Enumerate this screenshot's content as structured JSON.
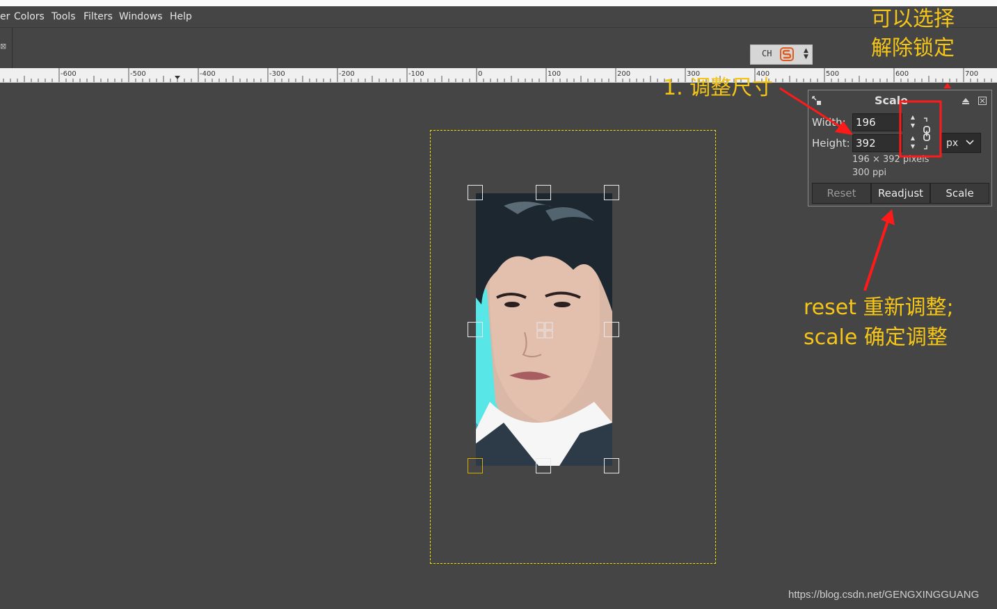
{
  "menubar": {
    "items": [
      "er",
      "Colors",
      "Tools",
      "Filters",
      "Windows",
      "Help"
    ]
  },
  "tool_options": {
    "close_glyph": "⊠"
  },
  "ime": {
    "mode": "CH",
    "logo": "sogou-s-icon"
  },
  "ruler": {
    "labels": [
      "0",
      "-600",
      "-500",
      "-400",
      "-300",
      "-200",
      "-100",
      "0",
      "100",
      "200",
      "300",
      "400",
      "500",
      "600",
      "700"
    ]
  },
  "scale_dialog": {
    "title": "Scale",
    "width_label": "Width:",
    "width_value": "196",
    "height_label": "Height:",
    "height_value": "392",
    "unit": "px",
    "size_info": "196 × 392 pixels",
    "resolution_info": "300 ppi",
    "buttons": {
      "reset": "Reset",
      "readjust": "Readjust",
      "scale": "Scale"
    }
  },
  "annotations": {
    "unlock_line1": "可以选择",
    "unlock_line2": "解除锁定",
    "resize": "1. 调整尺寸",
    "bottom_line1": "reset 重新调整;",
    "bottom_line2": "scale 确定调整"
  },
  "watermark": "https://blog.csdn.net/GENGXINGGUANG",
  "colors": {
    "canvas_bg": "#454545",
    "annotation_text": "#f5c518",
    "annotation_arrow": "#ff1a1a",
    "layer_boundary": "#f2e000"
  }
}
